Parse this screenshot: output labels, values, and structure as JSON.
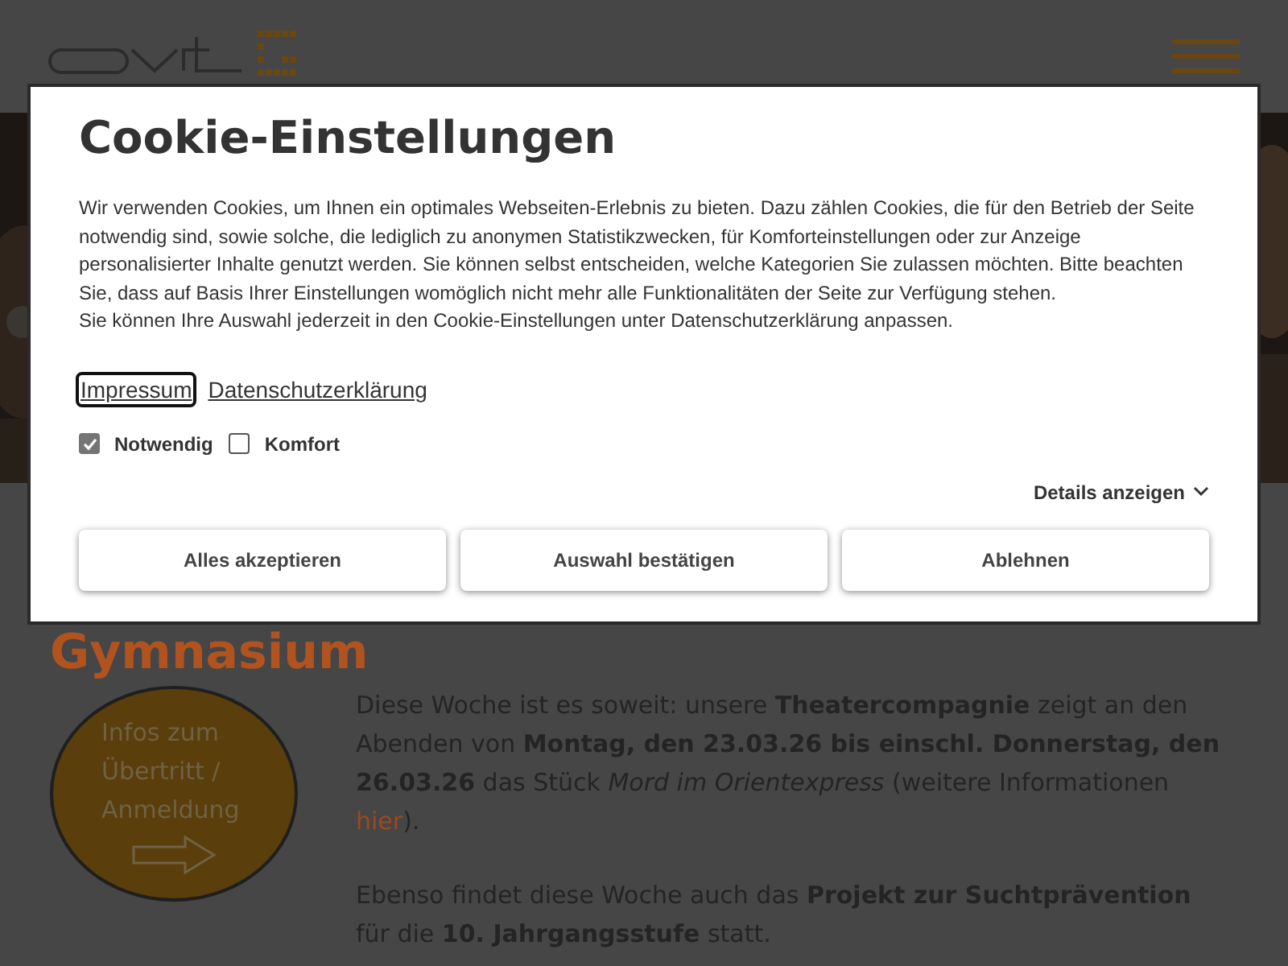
{
  "dialog": {
    "title": "Cookie-Einstellungen",
    "paragraphs": [
      "Wir verwenden Cookies, um Ihnen ein optimales Webseiten-Erlebnis zu bieten. Dazu zählen Cookies, die für den Betrieb der Seite notwendig sind, sowie solche, die lediglich zu anonymen Statistikzwecken, für Komforteinstellungen oder zur Anzeige personalisierter Inhalte genutzt werden. Sie können selbst entscheiden, welche Kategorien Sie zulassen möchten. Bitte beachten Sie, dass auf Basis Ihrer Einstellungen womöglich nicht mehr alle Funktionalitäten der Seite zur Verfügung stehen.",
      "Sie können Ihre Auswahl jederzeit in den Cookie-Einstellungen unter Datenschutzerklärung anpassen."
    ],
    "links": [
      {
        "label": "Impressum",
        "focused": true
      },
      {
        "label": "Datenschutzerklärung",
        "focused": false
      }
    ],
    "categories": [
      {
        "label": "Notwendig",
        "checked": true,
        "disabled": true
      },
      {
        "label": "Komfort",
        "checked": false,
        "disabled": false
      }
    ],
    "details_toggle": "Details anzeigen",
    "buttons": [
      "Alles akzeptieren",
      "Auswahl bestätigen",
      "Ablehnen"
    ]
  },
  "page": {
    "heading": "Gymnasium",
    "info_badge": "Infos zum Übertritt / Anmeldung",
    "news": [
      {
        "text": "Diese Woche ist es soweit: unsere **Theatercompagnie** zeigt an den Abenden von **Montag, den 23.03.26 bis einschl. Donnerstag, den 26.03.26** das Stück *Mord im Orientexpress* (weitere Informationen ",
        "link": "hier",
        "after": ")."
      },
      {
        "text": "Ebenso findet diese Woche auch das **Projekt zur Suchtprävention** für die **10. Jahrgangsstufe** statt."
      }
    ]
  }
}
